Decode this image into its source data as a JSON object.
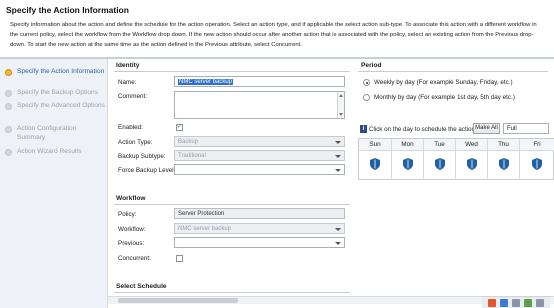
{
  "header": {
    "title": "Specify the Action Information",
    "description": "Specify information about the action and define the schedule for the action operation. Select an action type, and if applicable the select action sub-type. To associate this action with a different workflow in the current policy, select the workflow from the Workflow drop down. If the new action should occur after another action that is associated with the policy, select an existing action from the Previous drop-down. To start the new action at the same time as the action defined in the Previous attribute, select Concurrent."
  },
  "wizard_steps": [
    {
      "label": "Specify the Action Information",
      "active": true
    },
    {
      "label": "Specify the Backup Options",
      "active": false
    },
    {
      "label": "Specify the Advanced Options",
      "active": false
    },
    {
      "label": "Action Configuration Summary",
      "active": false
    },
    {
      "label": "Action Wizard Results",
      "active": false
    }
  ],
  "identity": {
    "section_title": "Identity",
    "name_label": "Name:",
    "name_value": "NMC server backup",
    "comment_label": "Comment:",
    "enabled_label": "Enabled:",
    "enabled_checked": true,
    "action_type_label": "Action Type:",
    "action_type_value": "Backup",
    "backup_subtype_label": "Backup Subtype:",
    "backup_subtype_value": "Traditional",
    "force_backup_level_label": "Force Backup Level:",
    "force_backup_level_value": ""
  },
  "workflow": {
    "section_title": "Workflow",
    "policy_label": "Policy:",
    "policy_value": "Server Protection",
    "workflow_label": "Workflow:",
    "workflow_value": "NMC server backup",
    "previous_label": "Previous:",
    "previous_value": "",
    "concurrent_label": "Concurrent:",
    "concurrent_checked": false
  },
  "select_schedule": {
    "section_title": "Select Schedule"
  },
  "period": {
    "section_title": "Period",
    "options": [
      {
        "label": "Weekly by day (For example Sunday, Friday, etc.)",
        "selected": true
      },
      {
        "label": "Monthly by day (For example 1st day, 5th day etc.)",
        "selected": false
      }
    ]
  },
  "schedule": {
    "click_label": "Click on the day to schedule the action",
    "make_all_label": "Make All",
    "level_value": "Full",
    "days": [
      "Sun",
      "Mon",
      "Tue",
      "Wed",
      "Thu",
      "Fri"
    ],
    "shield_color": "#1f5fa8"
  }
}
